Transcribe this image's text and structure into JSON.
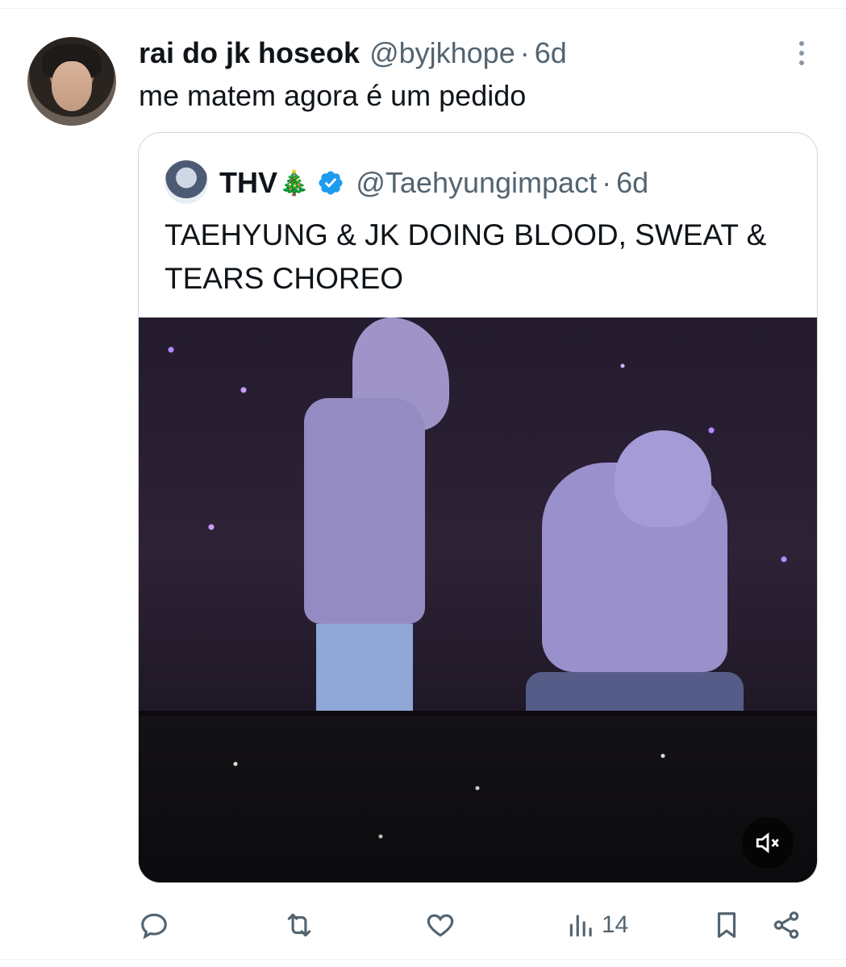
{
  "tweet": {
    "display_name": "rai do jk hoseok",
    "handle": "@byjkhope",
    "separator": "·",
    "time": "6d",
    "text": "me matem agora é um pedido"
  },
  "quote": {
    "display_name": "THV",
    "emoji": "🎄",
    "verified": true,
    "handle": "@Taehyungimpact",
    "separator": "·",
    "time": "6d",
    "text": "TAEHYUNG & JK DOING BLOOD, SWEAT & TEARS CHOREO"
  },
  "media": {
    "type": "video",
    "muted": true
  },
  "actions": {
    "views_count": "14"
  },
  "colors": {
    "accent": "#1d9bf0",
    "secondary_text": "#536471",
    "primary_text": "#0f1419",
    "border": "#cfd9de"
  },
  "icons": [
    "more-icon",
    "verified-badge-icon",
    "mute-icon",
    "reply-icon",
    "retweet-icon",
    "like-icon",
    "views-icon",
    "bookmark-icon",
    "share-icon"
  ]
}
